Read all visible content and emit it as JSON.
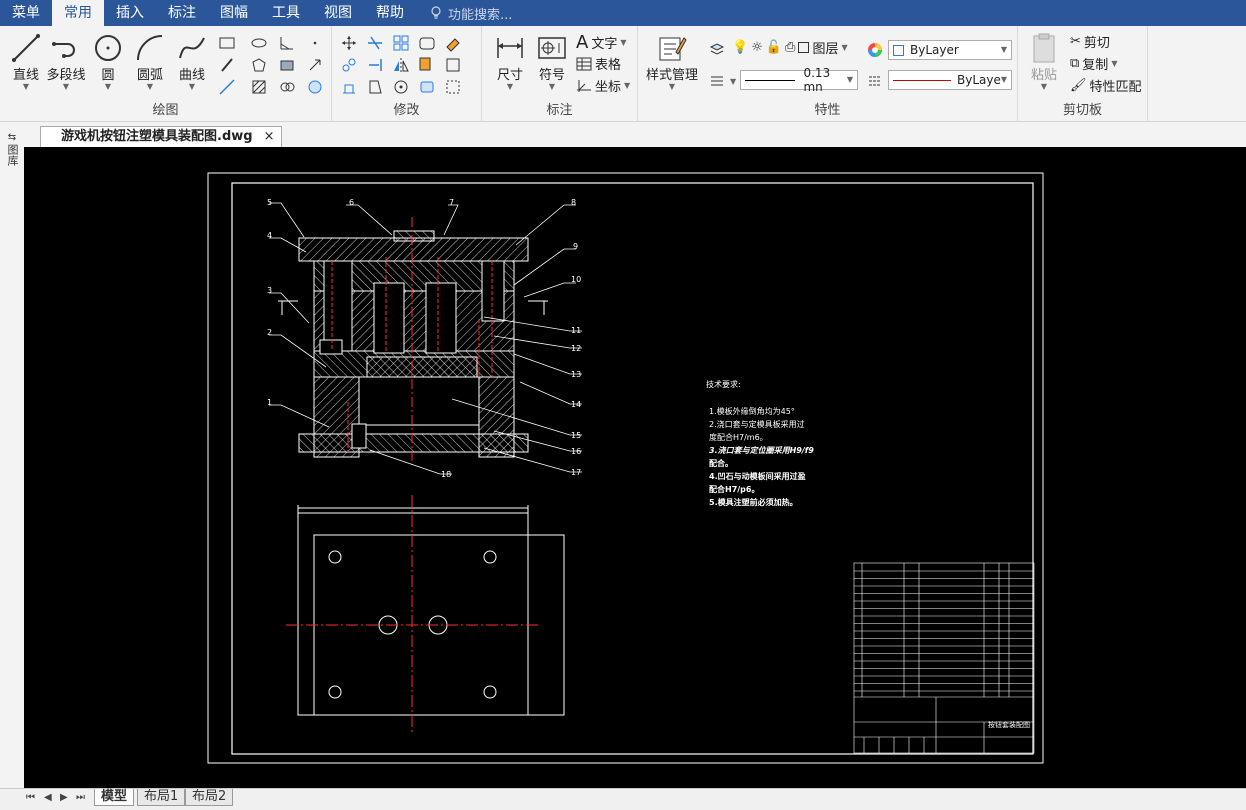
{
  "menubar": {
    "items": [
      "菜单",
      "常用",
      "插入",
      "标注",
      "图幅",
      "工具",
      "视图",
      "帮助"
    ],
    "active_index": 1,
    "search_placeholder": "功能搜索..."
  },
  "ribbon": {
    "groups": {
      "draw": "绘图",
      "modify": "修改",
      "annotate": "标注",
      "properties": "特性",
      "clipboard": "剪切板"
    },
    "draw": {
      "line": "直线",
      "polyline": "多段线",
      "circle": "圆",
      "arc": "圆弧",
      "curve": "曲线"
    },
    "annotate": {
      "dimension": "尺寸",
      "symbol": "符号",
      "text": "文字",
      "table": "表格",
      "coordinate": "坐标"
    },
    "properties": {
      "style_manager": "样式管理",
      "layer": "图层",
      "color": "ByLayer",
      "lineweight": "0.13 mn",
      "linetype": "ByLaye"
    },
    "clipboard": {
      "paste": "粘贴",
      "cut": "剪切",
      "copy": "复制",
      "match": "特性匹配"
    }
  },
  "document": {
    "tab_title": "游戏机按钮注塑模具装配图.dwg",
    "close_glyph": "×"
  },
  "leftbar": {
    "label": "图库"
  },
  "drawing": {
    "tech_title": "技术要求:",
    "tech_lines": [
      "1.模板外缘倒角均为45°",
      "2.浇口套与定模具板采用过",
      "度配合H7/m6。",
      "3.浇口套与定位圈采用H9/f9",
      "配合。",
      "4.凹石与动模板间采用过盈",
      "配合H7/p6。",
      "5.模具注塑前必须加热。"
    ],
    "callouts": [
      "1",
      "2",
      "3",
      "4",
      "5",
      "6",
      "7",
      "8",
      "9",
      "10",
      "11",
      "12",
      "13",
      "14",
      "15",
      "16",
      "17",
      "18"
    ],
    "title_block_name": "按钮套装配图"
  },
  "layouts": {
    "tabs": [
      "模型",
      "布局1",
      "布局2"
    ],
    "active_index": 0,
    "nav": [
      "⏮",
      "◀",
      "▶",
      "⏭"
    ]
  },
  "colors": {
    "accent": "#2b579a",
    "canvas": "#000000",
    "red": "#ff2a2a"
  }
}
